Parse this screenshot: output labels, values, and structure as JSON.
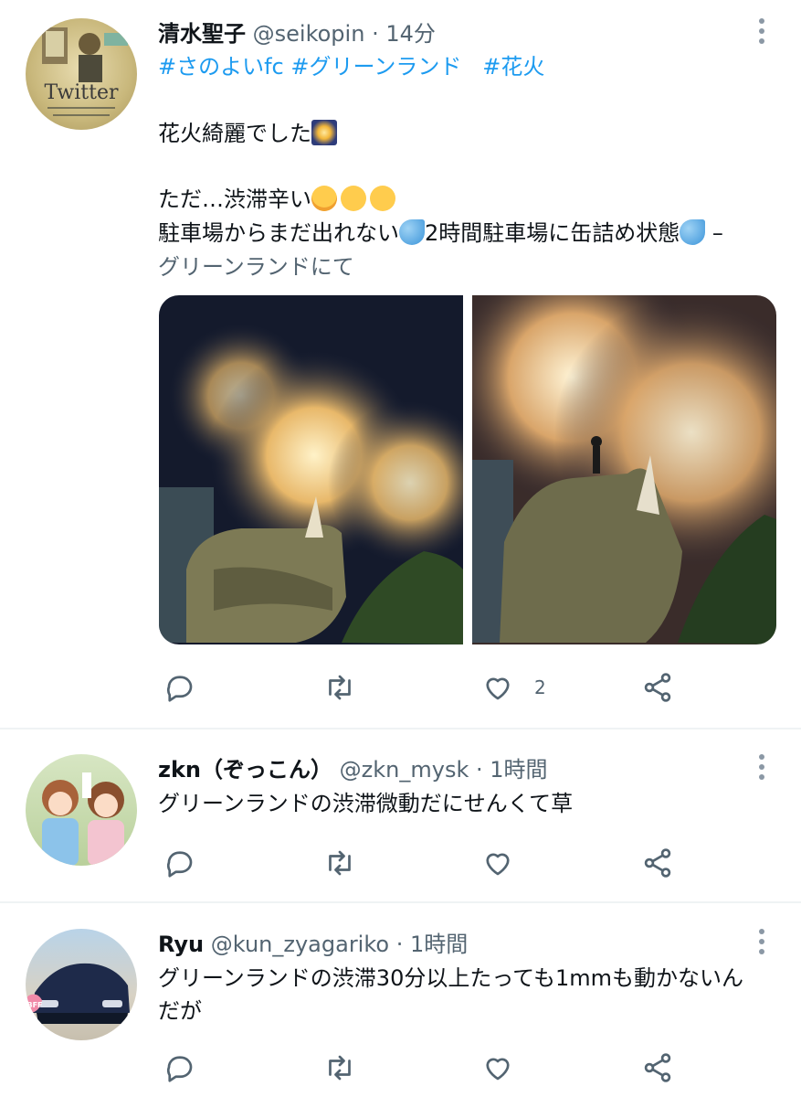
{
  "tweets": [
    {
      "name": "清水聖子",
      "handle": "@seikopin",
      "time": "14分",
      "hashtags": [
        "#さのよいfc",
        "#グリーンランド",
        "#花火"
      ],
      "line1": "花火綺麗でした",
      "line2": "ただ…渋滞辛い",
      "line3a": "駐車場からまだ出れない",
      "line3b": "2時間駐車場に缶詰め状態",
      "line3c": " –",
      "place": "グリーンランドにて",
      "likes": "2"
    },
    {
      "name": "zkn（ぞっこん）",
      "handle": "@zkn_mysk",
      "time": "1時間",
      "text": "グリーンランドの渋滞微動だにせんくて草"
    },
    {
      "name": "Ryu",
      "handle": "@kun_zyagariko",
      "time": "1時間",
      "text1": "グリーンランドの渋滞30分以上たっても1mmも動かないん",
      "text2": "だが"
    }
  ],
  "avatar1_text": "Twitter",
  "avatar3_badge": "BFF",
  "colors": {
    "link": "#1d9bf0",
    "secondary": "#536471",
    "divider": "#eff3f4"
  }
}
